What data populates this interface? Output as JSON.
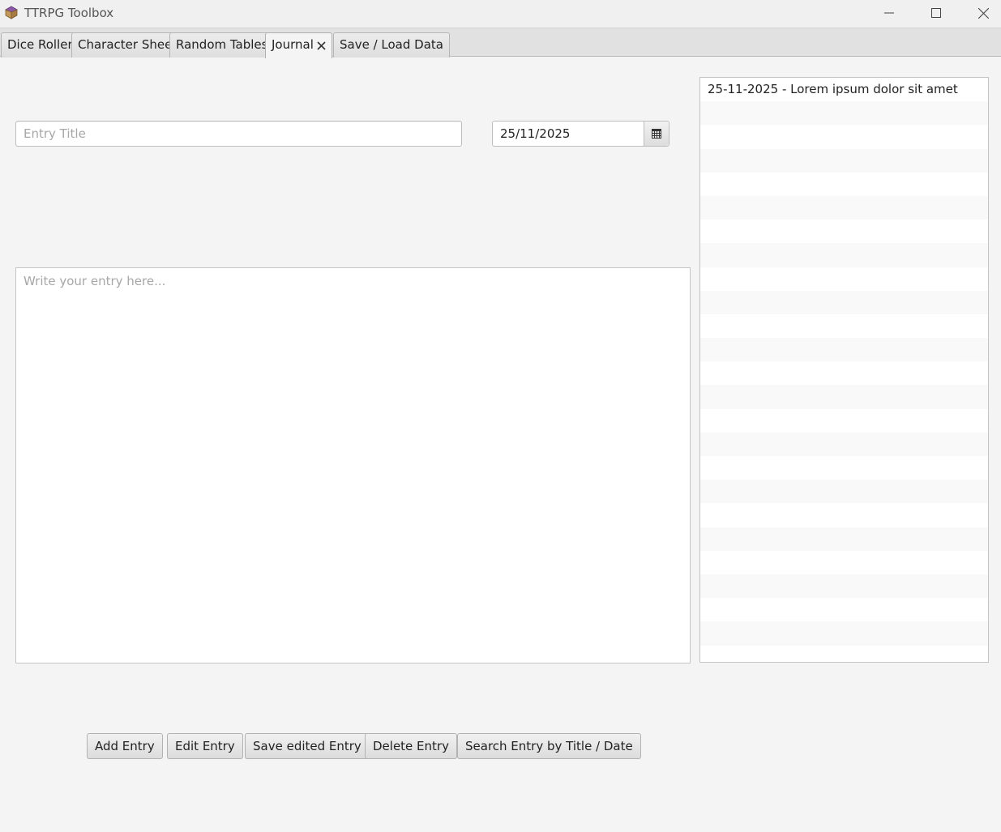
{
  "window": {
    "title": "TTRPG Toolbox",
    "icon": "treasure-chest-icon",
    "controls": [
      "minimize-icon",
      "maximize-icon",
      "close-icon"
    ]
  },
  "tabs": [
    {
      "label": "Dice Roller",
      "active": false
    },
    {
      "label": "Character Sheet",
      "active": false
    },
    {
      "label": "Random Tables",
      "active": false
    },
    {
      "label": "Journal",
      "active": true,
      "closable": true
    },
    {
      "label": "Save / Load Data",
      "active": false
    }
  ],
  "journal": {
    "title_input": {
      "value": "",
      "placeholder": "Entry Title"
    },
    "date_picker": {
      "value": "25/11/2025",
      "icon": "calendar-icon"
    },
    "entry_text": {
      "value": "",
      "placeholder": "Write your entry here..."
    },
    "entries": [
      "25-11-2025 - Lorem ipsum dolor sit amet"
    ],
    "buttons": {
      "add": "Add Entry",
      "edit": "Edit Entry",
      "save_edited": "Save edited Entry",
      "delete": "Delete Entry",
      "search": "Search Entry by Title / Date"
    }
  }
}
